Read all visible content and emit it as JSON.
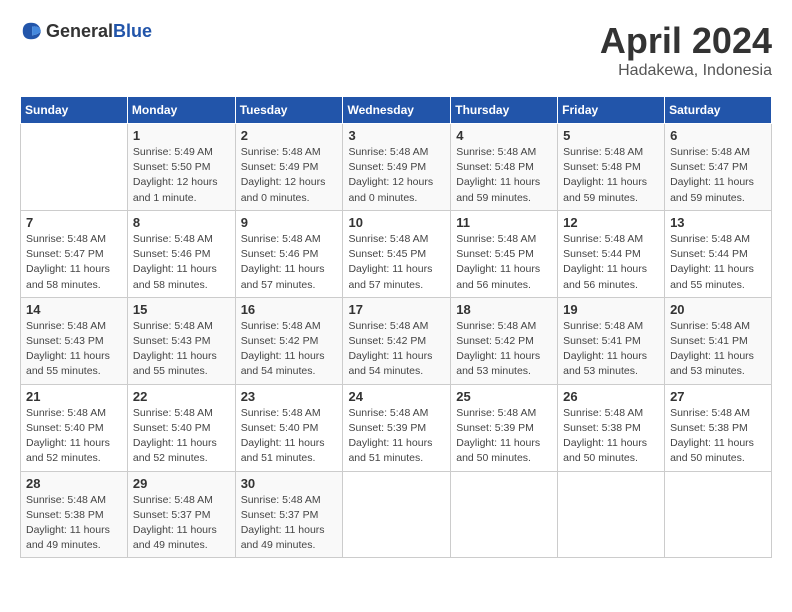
{
  "header": {
    "logo_general": "General",
    "logo_blue": "Blue",
    "month": "April 2024",
    "location": "Hadakewa, Indonesia"
  },
  "weekdays": [
    "Sunday",
    "Monday",
    "Tuesday",
    "Wednesday",
    "Thursday",
    "Friday",
    "Saturday"
  ],
  "weeks": [
    [
      {
        "day": "",
        "info": ""
      },
      {
        "day": "1",
        "info": "Sunrise: 5:49 AM\nSunset: 5:50 PM\nDaylight: 12 hours\nand 1 minute."
      },
      {
        "day": "2",
        "info": "Sunrise: 5:48 AM\nSunset: 5:49 PM\nDaylight: 12 hours\nand 0 minutes."
      },
      {
        "day": "3",
        "info": "Sunrise: 5:48 AM\nSunset: 5:49 PM\nDaylight: 12 hours\nand 0 minutes."
      },
      {
        "day": "4",
        "info": "Sunrise: 5:48 AM\nSunset: 5:48 PM\nDaylight: 11 hours\nand 59 minutes."
      },
      {
        "day": "5",
        "info": "Sunrise: 5:48 AM\nSunset: 5:48 PM\nDaylight: 11 hours\nand 59 minutes."
      },
      {
        "day": "6",
        "info": "Sunrise: 5:48 AM\nSunset: 5:47 PM\nDaylight: 11 hours\nand 59 minutes."
      }
    ],
    [
      {
        "day": "7",
        "info": ""
      },
      {
        "day": "8",
        "info": "Sunrise: 5:48 AM\nSunset: 5:46 PM\nDaylight: 11 hours\nand 58 minutes."
      },
      {
        "day": "9",
        "info": "Sunrise: 5:48 AM\nSunset: 5:46 PM\nDaylight: 11 hours\nand 57 minutes."
      },
      {
        "day": "10",
        "info": "Sunrise: 5:48 AM\nSunset: 5:45 PM\nDaylight: 11 hours\nand 57 minutes."
      },
      {
        "day": "11",
        "info": "Sunrise: 5:48 AM\nSunset: 5:45 PM\nDaylight: 11 hours\nand 56 minutes."
      },
      {
        "day": "12",
        "info": "Sunrise: 5:48 AM\nSunset: 5:44 PM\nDaylight: 11 hours\nand 56 minutes."
      },
      {
        "day": "13",
        "info": "Sunrise: 5:48 AM\nSunset: 5:44 PM\nDaylight: 11 hours\nand 55 minutes."
      }
    ],
    [
      {
        "day": "14",
        "info": ""
      },
      {
        "day": "15",
        "info": "Sunrise: 5:48 AM\nSunset: 5:43 PM\nDaylight: 11 hours\nand 55 minutes."
      },
      {
        "day": "16",
        "info": "Sunrise: 5:48 AM\nSunset: 5:42 PM\nDaylight: 11 hours\nand 54 minutes."
      },
      {
        "day": "17",
        "info": "Sunrise: 5:48 AM\nSunset: 5:42 PM\nDaylight: 11 hours\nand 54 minutes."
      },
      {
        "day": "18",
        "info": "Sunrise: 5:48 AM\nSunset: 5:42 PM\nDaylight: 11 hours\nand 53 minutes."
      },
      {
        "day": "19",
        "info": "Sunrise: 5:48 AM\nSunset: 5:41 PM\nDaylight: 11 hours\nand 53 minutes."
      },
      {
        "day": "20",
        "info": "Sunrise: 5:48 AM\nSunset: 5:41 PM\nDaylight: 11 hours\nand 53 minutes."
      }
    ],
    [
      {
        "day": "21",
        "info": ""
      },
      {
        "day": "22",
        "info": "Sunrise: 5:48 AM\nSunset: 5:40 PM\nDaylight: 11 hours\nand 52 minutes."
      },
      {
        "day": "23",
        "info": "Sunrise: 5:48 AM\nSunset: 5:40 PM\nDaylight: 11 hours\nand 51 minutes."
      },
      {
        "day": "24",
        "info": "Sunrise: 5:48 AM\nSunset: 5:39 PM\nDaylight: 11 hours\nand 51 minutes."
      },
      {
        "day": "25",
        "info": "Sunrise: 5:48 AM\nSunset: 5:39 PM\nDaylight: 11 hours\nand 50 minutes."
      },
      {
        "day": "26",
        "info": "Sunrise: 5:48 AM\nSunset: 5:38 PM\nDaylight: 11 hours\nand 50 minutes."
      },
      {
        "day": "27",
        "info": "Sunrise: 5:48 AM\nSunset: 5:38 PM\nDaylight: 11 hours\nand 50 minutes."
      }
    ],
    [
      {
        "day": "28",
        "info": "Sunrise: 5:48 AM\nSunset: 5:38 PM\nDaylight: 11 hours\nand 49 minutes."
      },
      {
        "day": "29",
        "info": "Sunrise: 5:48 AM\nSunset: 5:37 PM\nDaylight: 11 hours\nand 49 minutes."
      },
      {
        "day": "30",
        "info": "Sunrise: 5:48 AM\nSunset: 5:37 PM\nDaylight: 11 hours\nand 49 minutes."
      },
      {
        "day": "",
        "info": ""
      },
      {
        "day": "",
        "info": ""
      },
      {
        "day": "",
        "info": ""
      },
      {
        "day": "",
        "info": ""
      }
    ]
  ],
  "week1_sunday": {
    "day": "7",
    "info": "Sunrise: 5:48 AM\nSunset: 5:47 PM\nDaylight: 11 hours\nand 58 minutes."
  },
  "week2_sunday": {
    "day": "14",
    "info": "Sunrise: 5:48 AM\nSunset: 5:43 PM\nDaylight: 11 hours\nand 55 minutes."
  },
  "week3_sunday": {
    "day": "21",
    "info": "Sunrise: 5:48 AM\nSunset: 5:40 PM\nDaylight: 11 hours\nand 52 minutes."
  }
}
